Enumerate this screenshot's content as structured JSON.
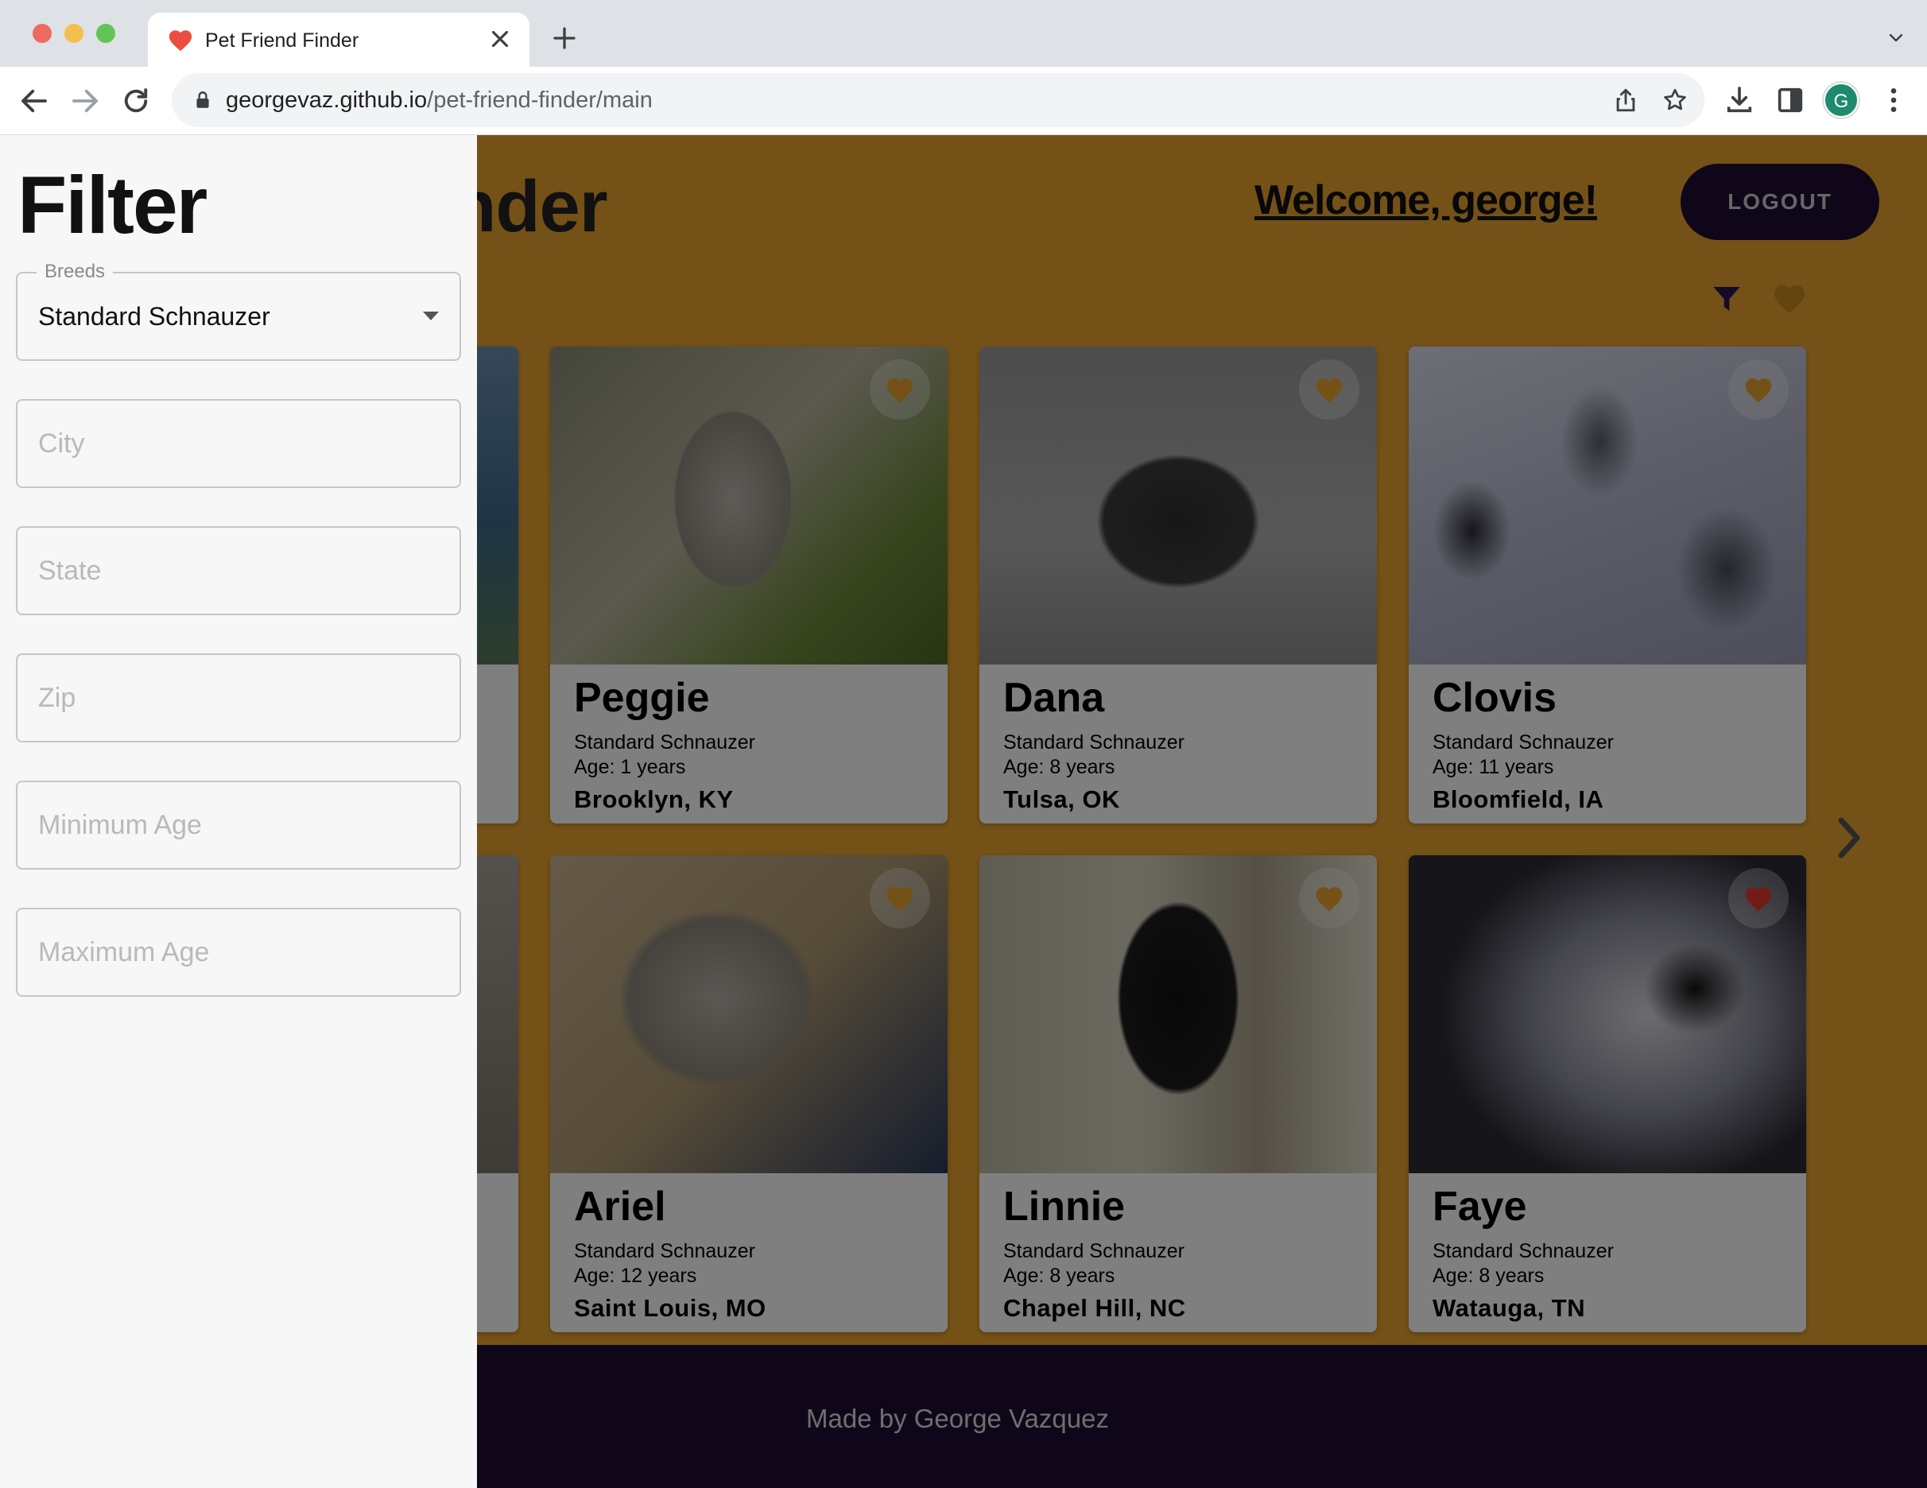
{
  "browser": {
    "tab_title": "Pet Friend Finder",
    "url_host": "georgevaz.github.io",
    "url_path": "/pet-friend-finder/main",
    "profile_initial": "G"
  },
  "header": {
    "app_title": "Pet Friend Finder",
    "welcome": "Welcome, george!",
    "logout_label": "LOGOUT"
  },
  "filter": {
    "title": "Filter",
    "breeds_label": "Breeds",
    "breeds_value": "Standard Schnauzer",
    "city_placeholder": "City",
    "state_placeholder": "State",
    "zip_placeholder": "Zip",
    "min_age_placeholder": "Minimum Age",
    "max_age_placeholder": "Maximum Age"
  },
  "dogs": [
    {
      "name": "Peggie",
      "breed": "Standard Schnauzer",
      "age": "Age: 1 years",
      "location": "Brooklyn, KY",
      "favorited": false
    },
    {
      "name": "Dana",
      "breed": "Standard Schnauzer",
      "age": "Age: 8 years",
      "location": "Tulsa, OK",
      "favorited": false
    },
    {
      "name": "Clovis",
      "breed": "Standard Schnauzer",
      "age": "Age: 11 years",
      "location": "Bloomfield, IA",
      "favorited": false
    },
    {
      "name": "Ariel",
      "breed": "Standard Schnauzer",
      "age": "Age: 12 years",
      "location": "Saint Louis, MO",
      "favorited": false
    },
    {
      "name": "Linnie",
      "breed": "Standard Schnauzer",
      "age": "Age: 8 years",
      "location": "Chapel Hill, NC",
      "favorited": false
    },
    {
      "name": "Faye",
      "breed": "Standard Schnauzer",
      "age": "Age: 8 years",
      "location": "Watauga, TN",
      "favorited": true
    }
  ],
  "footer": {
    "credit": "Made by George Vazquez"
  },
  "colors": {
    "page_background": "#e9a22e",
    "dark_purple": "#1f0e33",
    "heart_default": "#e9a22e",
    "heart_favorited": "#e53935"
  }
}
